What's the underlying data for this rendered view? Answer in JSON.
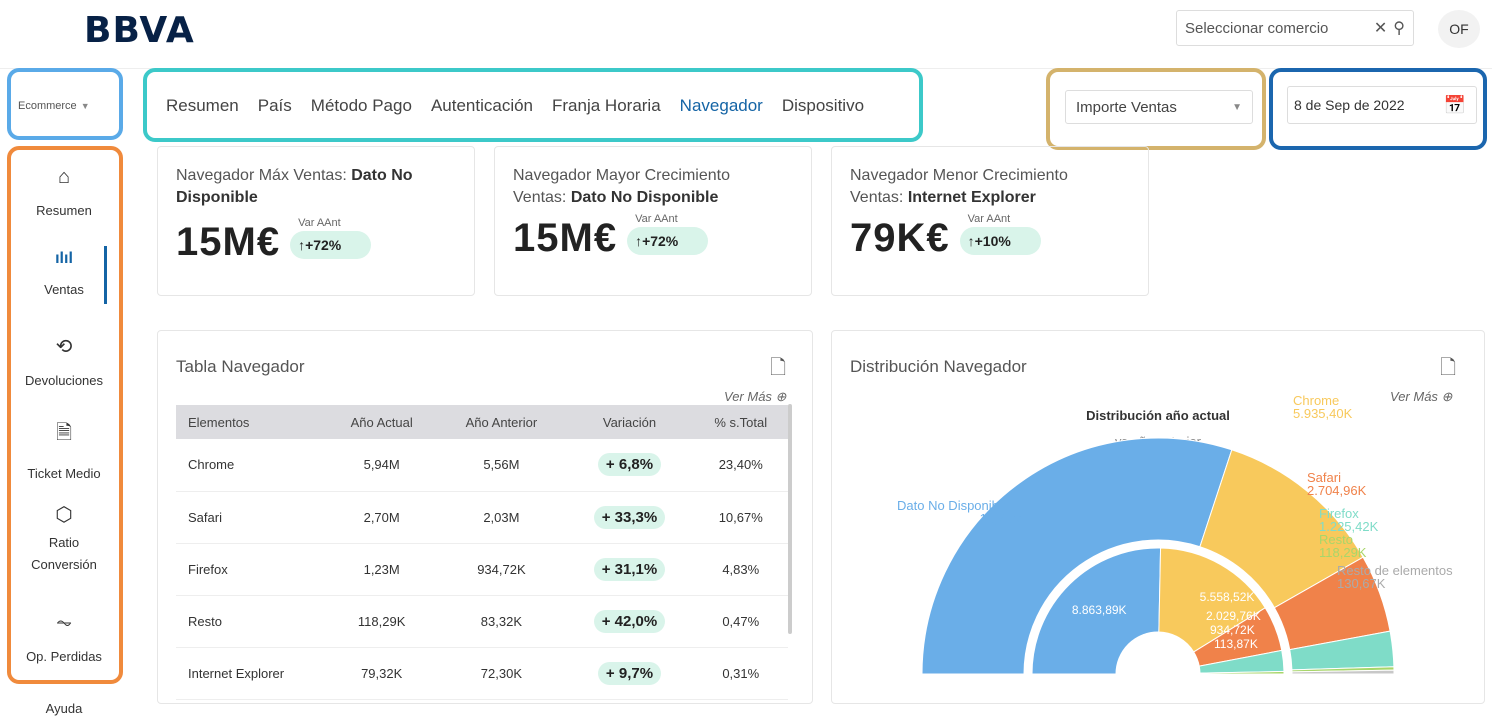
{
  "header": {
    "logo": "BBVA",
    "search_placeholder": "Seleccionar comercio",
    "clear_icon": "close-icon",
    "search_icon": "search-icon",
    "avatar": "OF"
  },
  "channel_select": {
    "value": "Ecommerce"
  },
  "sidebar": {
    "items": [
      {
        "label": "Resumen",
        "icon": "home-icon"
      },
      {
        "label": "Ventas",
        "icon": "bar-chart-icon",
        "active": true
      },
      {
        "label": "Devoluciones",
        "icon": "refund-icon"
      },
      {
        "label": "Ticket Medio",
        "icon": "document-icon"
      },
      {
        "label": "Ratio\nConversión",
        "icon": "percent-badge-icon"
      },
      {
        "label": "Op. Perdidas",
        "icon": "trend-down-icon"
      },
      {
        "label": "Ayuda"
      }
    ]
  },
  "tabs": [
    "Resumen",
    "País",
    "Método Pago",
    "Autenticación",
    "Franja Horaria",
    "Navegador",
    "Dispositivo"
  ],
  "active_tab": "Navegador",
  "metric_select": {
    "value": "Importe Ventas"
  },
  "date_picker": {
    "value": "8 de Sep de 2022",
    "icon": "calendar-icon"
  },
  "kpis": [
    {
      "title": "Navegador Máx Ventas: ",
      "bold": "Dato No Disponible",
      "value": "15M€",
      "var_label": "Var AAnt",
      "var": "↑+72%"
    },
    {
      "title": "Navegador Mayor Crecimiento Ventas: ",
      "bold": "Dato No Disponible",
      "value": "15M€",
      "var_label": "Var AAnt",
      "var": "↑+72%"
    },
    {
      "title": "Navegador Menor Crecimiento Ventas: ",
      "bold": "Internet Explorer",
      "value": "79K€",
      "var_label": "Var AAnt",
      "var": "↑+10%"
    }
  ],
  "table_card": {
    "title": "Tabla Navegador",
    "ver_mas": "Ver Más",
    "columns": [
      "Elementos",
      "Año Actual",
      "Año Anterior",
      "Variación",
      "% s.Total"
    ],
    "rows": [
      [
        "Chrome",
        "5,94M",
        "5,56M",
        "+ 6,8%",
        "23,40%"
      ],
      [
        "Safari",
        "2,70M",
        "2,03M",
        "+ 33,3%",
        "10,67%"
      ],
      [
        "Firefox",
        "1,23M",
        "934,72K",
        "+ 31,1%",
        "4,83%"
      ],
      [
        "Resto",
        "118,29K",
        "83,32K",
        "+ 42,0%",
        "0,47%"
      ],
      [
        "Internet Explorer",
        "79,32K",
        "72,30K",
        "+ 9,7%",
        "0,31%"
      ]
    ]
  },
  "chart_card": {
    "title": "Distribución Navegador",
    "ver_mas": "Ver Más",
    "subtitle": "Distribución año actual",
    "subtitle2": "vs año anterior"
  },
  "chart_data": {
    "type": "pie",
    "subtype": "nested-semi-donut",
    "outer": {
      "label": "año actual",
      "series": [
        {
          "name": "Dato No Disponible",
          "value": 15250,
          "label": "15,25M",
          "color": "#6aaee8"
        },
        {
          "name": "Chrome",
          "value": 5935.4,
          "label": "5.935,40K",
          "color": "#f8c95c"
        },
        {
          "name": "Safari",
          "value": 2704.96,
          "label": "2.704,96K",
          "color": "#f0824a"
        },
        {
          "name": "Firefox",
          "value": 1225.42,
          "label": "1.225,42K",
          "color": "#7fdcc8"
        },
        {
          "name": "Resto",
          "value": 118.29,
          "label": "118,29K",
          "color": "#a8d66a"
        },
        {
          "name": "Resto de elementos",
          "value": 130.67,
          "label": "130,67K",
          "color": "#c8c8c8"
        }
      ]
    },
    "inner": {
      "label": "año anterior",
      "series": [
        {
          "name": "Dato No Disponible",
          "value": 8863.89,
          "label": "8.863,89K",
          "color": "#6aaee8"
        },
        {
          "name": "Chrome",
          "value": 5558.52,
          "label": "5.558,52K",
          "color": "#f8c95c"
        },
        {
          "name": "Safari",
          "value": 2029.76,
          "label": "2.029,76K",
          "color": "#f0824a"
        },
        {
          "name": "Firefox",
          "value": 934.72,
          "label": "934,72K",
          "color": "#7fdcc8"
        },
        {
          "name": "Resto",
          "value": 113.87,
          "label": "113,87K",
          "color": "#a8d66a"
        }
      ]
    }
  }
}
